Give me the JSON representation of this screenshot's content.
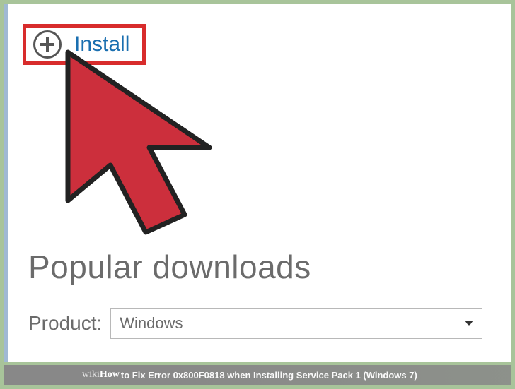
{
  "install": {
    "label": "Install"
  },
  "heading": "Popular downloads",
  "product": {
    "label": "Product:",
    "selected": "Windows"
  },
  "caption": {
    "brand_a": "wiki",
    "brand_b": "How",
    "rest": " to Fix Error 0x800F0818 when Installing Service Pack 1 (Windows 7)"
  }
}
